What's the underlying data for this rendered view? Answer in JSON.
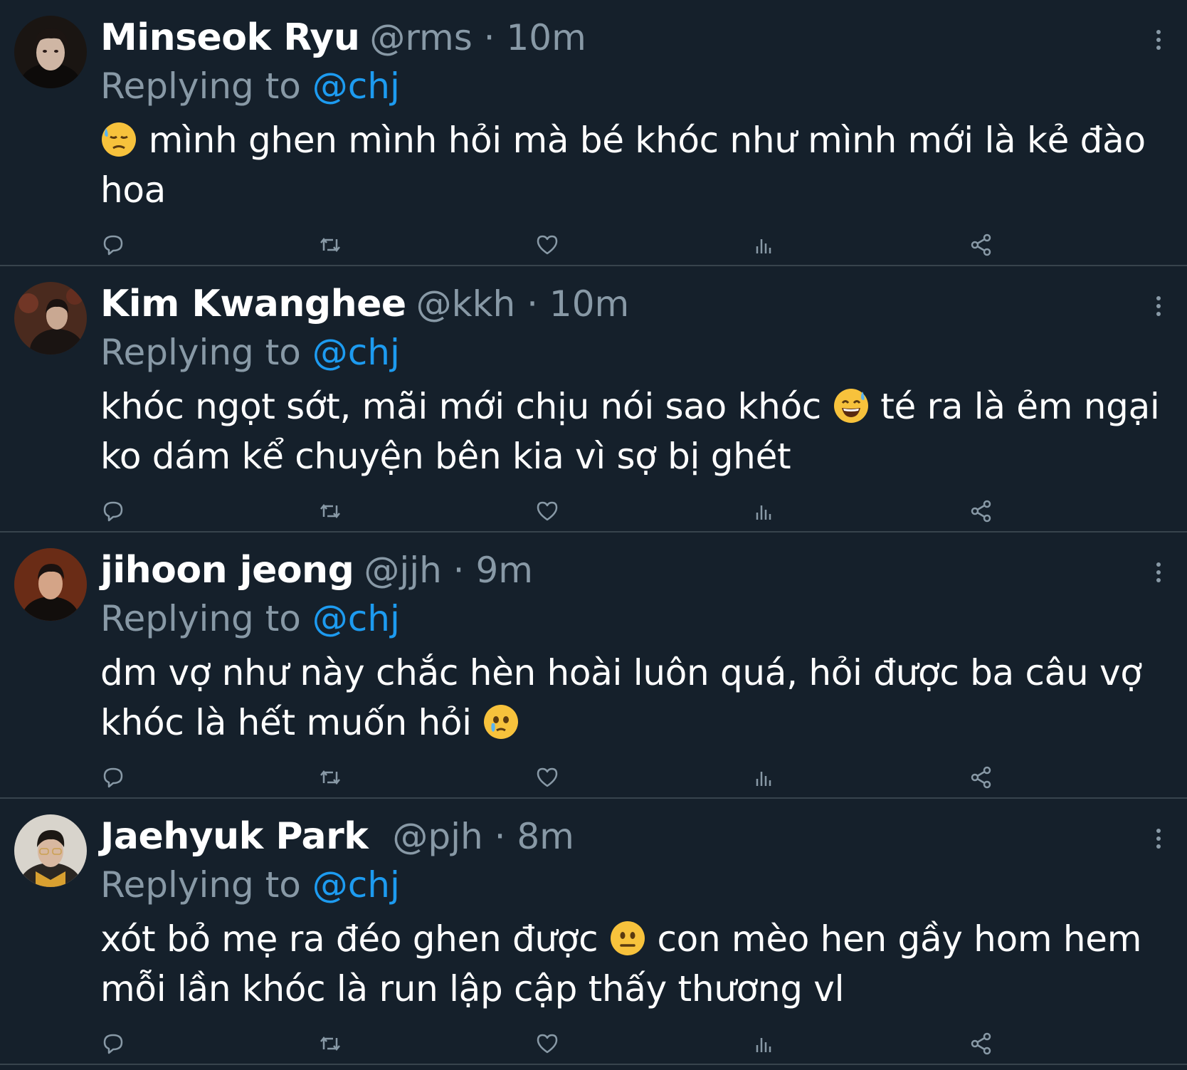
{
  "colors": {
    "background": "#15202b",
    "divider": "#38444d",
    "muted_text": "#8899a6",
    "mention": "#1d9bf0",
    "primary_text": "#ffffff"
  },
  "icons": [
    "reply-icon",
    "retweet-icon",
    "like-icon",
    "views-icon",
    "share-icon",
    "more-options-icon"
  ],
  "tweets": [
    {
      "name": "Minseok Ryu",
      "meta": "@rms · 10m",
      "replying_prefix": "Replying to",
      "replying_to": "@chj",
      "emoji": "downcast-face-with-sweat-emoji",
      "text_before_emoji": "",
      "text_after_emoji": " mình ghen mình hỏi mà bé khóc như mình mới là kẻ đào hoa"
    },
    {
      "name": "Kim Kwanghee",
      "meta": "@kkh · 10m",
      "replying_prefix": "Replying to",
      "replying_to": "@chj",
      "emoji": "grinning-face-with-sweat-emoji",
      "text_before_emoji": "khóc ngọt sớt, mãi mới chịu nói sao khóc ",
      "text_after_emoji": " té ra là ẻm ngại ko dám kể chuyện bên kia vì sợ bị ghét"
    },
    {
      "name": "jihoon jeong",
      "meta": "@jjh · 9m",
      "replying_prefix": "Replying to",
      "replying_to": "@chj",
      "emoji": "face-holding-back-tears-emoji",
      "text_before_emoji": "dm vợ như này chắc hèn hoài luôn quá, hỏi được ba câu vợ khóc là hết muốn hỏi ",
      "text_after_emoji": ""
    },
    {
      "name": "Jaehyuk Park",
      "meta": "@pjh · 8m",
      "replying_prefix": "Replying to",
      "replying_to": "@chj",
      "emoji": "neutral-face-emoji",
      "text_before_emoji": "xót bỏ mẹ ra đéo ghen được ",
      "text_after_emoji": " con mèo hen gầy hom hem mỗi lần khóc là run lập cập thấy thương vl"
    }
  ]
}
